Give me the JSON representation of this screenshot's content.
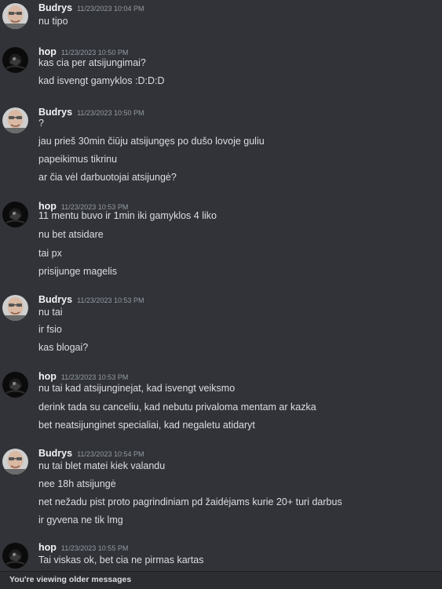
{
  "messages": [
    {
      "author": "Budrys",
      "timestamp": "11/23/2023 10:04 PM",
      "avatar": "budrys-avatar",
      "lines": [
        "nu tipo"
      ]
    },
    {
      "author": "hop",
      "timestamp": "11/23/2023 10:50 PM",
      "avatar": "hop-avatar",
      "lines": [
        "kas cia per atsijungimai?",
        "kad isvengt gamyklos :D:D:D"
      ]
    },
    {
      "author": "Budrys",
      "timestamp": "11/23/2023 10:50 PM",
      "avatar": "budrys-avatar",
      "lines": [
        "?",
        "jau prieš 30min čiūju atsijungęs po dušo lovoje guliu",
        "papeikimus tikrinu",
        "ar čia vėl darbuotojai atsijungė?"
      ]
    },
    {
      "author": "hop",
      "timestamp": "11/23/2023 10:53 PM",
      "avatar": "hop-avatar",
      "lines": [
        "11 mentu buvo ir 1min iki gamyklos 4 liko",
        "nu bet atsidare",
        "tai px",
        "prisijunge magelis"
      ]
    },
    {
      "author": "Budrys",
      "timestamp": "11/23/2023 10:53 PM",
      "avatar": "budrys-avatar",
      "lines": [
        "nu tai",
        "ir fsio",
        "kas blogai?"
      ]
    },
    {
      "author": "hop",
      "timestamp": "11/23/2023 10:53 PM",
      "avatar": "hop-avatar",
      "lines": [
        "nu tai kad atsijunginejat, kad isvengt veiksmo",
        "derink tada su canceliu, kad nebutu privaloma mentam ar kazka",
        "bet neatsijunginet specialiai, kad negaletu atidaryt"
      ]
    },
    {
      "author": "Budrys",
      "timestamp": "11/23/2023 10:54 PM",
      "avatar": "budrys-avatar",
      "lines": [
        "nu tai blet matei kiek valandu",
        "nee 18h atsijungė",
        "net nežadu pist proto pagrindiniam pd žaidėjams kurie 20+ turi darbus",
        "ir gyvena ne tik lmg"
      ]
    },
    {
      "author": "hop",
      "timestamp": "11/23/2023 10:55 PM",
      "avatar": "hop-avatar",
      "lines": [
        "Tai viskas ok, bet cia ne pirmas kartas"
      ]
    }
  ],
  "banner": {
    "text": "You're viewing older messages"
  }
}
